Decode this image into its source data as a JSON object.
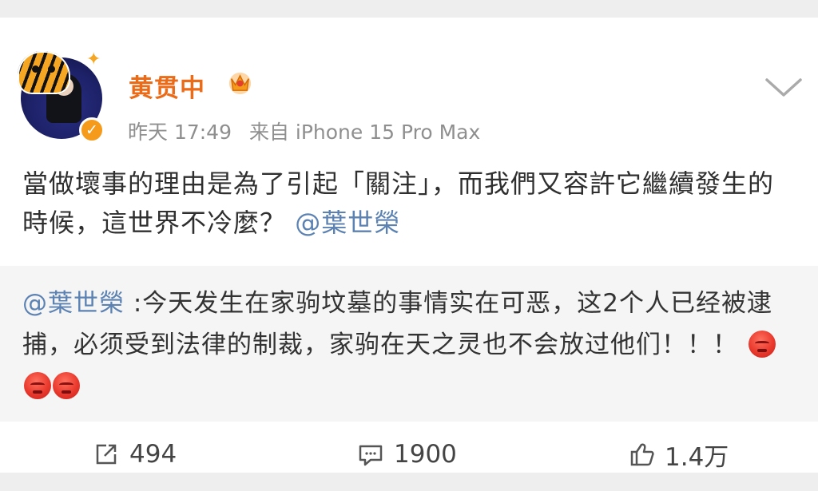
{
  "post": {
    "author": "黄贯中",
    "time": "昨天 17:49",
    "source": "来自 iPhone 15 Pro Max",
    "text": "當做壞事的理由是為了引起「關注」，而我們又容許它繼續發生的時候，這世界不冷麼？",
    "mention": "@葉世榮"
  },
  "quote": {
    "mention": "@葉世榮",
    "text": ":今天发生在家驹坟墓的事情实在可恶，这2个人已经被逮捕，必须受到法律的制裁，家驹在天之灵也不会放过他们！！！"
  },
  "actions": {
    "reposts": "494",
    "comments": "1900",
    "likes": "1.4万"
  },
  "colors": {
    "author": "#ea6b18",
    "mention": "#5b82b2",
    "muted": "#8f8f8f"
  }
}
